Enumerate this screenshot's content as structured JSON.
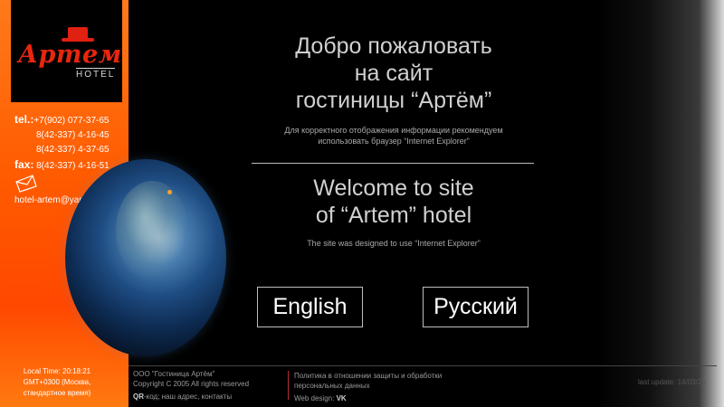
{
  "logo": {
    "word": "Артем",
    "sub": "HOTEL"
  },
  "contacts": {
    "tel_label": "tel.:",
    "tel_1": "+7(902) 077-37-65",
    "tel_2": "8(42-337) 4-16-45",
    "tel_3": "8(42-337) 4-37-65",
    "fax_label": "fax:",
    "fax": "8(42-337) 4-16-51",
    "email": "hotel-artem@yandex.ru"
  },
  "local_time": {
    "line1": "Local Time: 20:18:21",
    "line2": "GMT+0300 (Москва,",
    "line3": "стандартное время)"
  },
  "welcome_ru": {
    "line1": "Добро пожаловать",
    "line2": "на сайт",
    "line3": "гостиницы “Артём”",
    "hint1": "Для корректного отображения информации рекомендуем",
    "hint2": "использовать  браузер “Internet Explorer”"
  },
  "welcome_en": {
    "line1": "Welcome to site",
    "line2": "of “Artem” hotel",
    "hint": "The site was designed to use “Internet Explorer”"
  },
  "buttons": {
    "english": "English",
    "russian": "Русский"
  },
  "footer": {
    "company": "ООО \"Гостиница Артём\"",
    "copyright": "Copyright C 2005 All rights reserved",
    "qr_bold": "QR",
    "qr_text": "-код; наш адрес, контакты",
    "policy": "Политика в отношении защиты и обработки персональных данных",
    "design_label": "Web design:",
    "design_value": "VK",
    "updated": "last update:  14/03/25"
  },
  "colors": {
    "sidebar": "#ff5a00",
    "logo_red": "#e8260f",
    "background": "#000000"
  }
}
